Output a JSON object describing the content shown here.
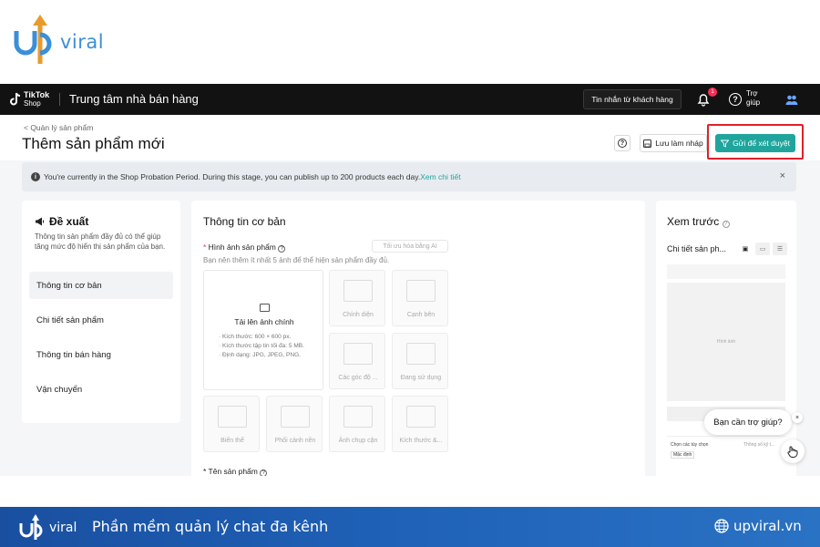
{
  "brand": {
    "logo_text": "viral",
    "tagline": "Phần mềm quản lý chat đa kênh",
    "website": "upviral.vn"
  },
  "header": {
    "platform_line1": "TikTok",
    "platform_line2": "Shop",
    "title": "Trung tâm nhà bán hàng",
    "message_button": "Tin nhắn từ khách hàng",
    "notification_count": "1",
    "help_label": "Trợ giúp"
  },
  "page": {
    "breadcrumb": "< Quản lý sản phẩm",
    "title": "Thêm sản phẩm mới",
    "save_draft_label": "Lưu làm nháp",
    "submit_label": "Gửi để xét duyệt",
    "banner_text": "You're currently in the Shop Probation Period. During this stage, you can publish up to 200 products each day.",
    "banner_link": "Xem chi tiết",
    "banner_close": "×"
  },
  "suggestion": {
    "title": "Đề xuất",
    "description": "Thông tin sản phẩm đầy đủ có thể giúp tăng mức độ hiển thị sản phẩm của bạn.",
    "items": [
      {
        "label": "Thông tin cơ bản"
      },
      {
        "label": "Chi tiết sản phẩm"
      },
      {
        "label": "Thông tin bán hàng"
      },
      {
        "label": "Vận chuyển"
      }
    ]
  },
  "form": {
    "section_title": "Thông tin cơ bản",
    "images_label": "Hình ảnh sản phẩm",
    "ai_button": "Tối ưu hóa bằng AI",
    "images_hint": "Bạn nên thêm ít nhất 5 ảnh để thể hiện sản phẩm đầy đủ.",
    "upload_main_label": "Tải lên ảnh chính",
    "upload_specs": [
      "· Kích thước: 600 × 600 px.",
      "· Kích thước tập tin tối đa: 5 MB.",
      "· Định dạng: JPG, JPEG, PNG."
    ],
    "slots": [
      {
        "label": "Chính diện"
      },
      {
        "label": "Cạnh bên"
      },
      {
        "label": "Các góc độ ..."
      },
      {
        "label": "Đang sử dụng"
      },
      {
        "label": "Biến thể"
      },
      {
        "label": "Phối cảnh nền"
      },
      {
        "label": "Ảnh chụp cận"
      },
      {
        "label": "Kích thước &..."
      }
    ],
    "product_name_label": "Tên sản phẩm"
  },
  "preview": {
    "title": "Xem trước",
    "subtitle": "Chi tiết sản ph...",
    "image_placeholder": "Hình ảnh",
    "card_option": "Chọn các tùy chọn",
    "card_right": "Thông số kỹ t...",
    "card_tag": "Mặc định"
  },
  "help_widget": {
    "text": "Bạn cần trợ giúp?",
    "close": "×"
  },
  "colors": {
    "accent": "#1fa59d",
    "highlight_box": "#e0202a",
    "header_bg": "#121212",
    "brand_bar": "#1f62b8"
  }
}
